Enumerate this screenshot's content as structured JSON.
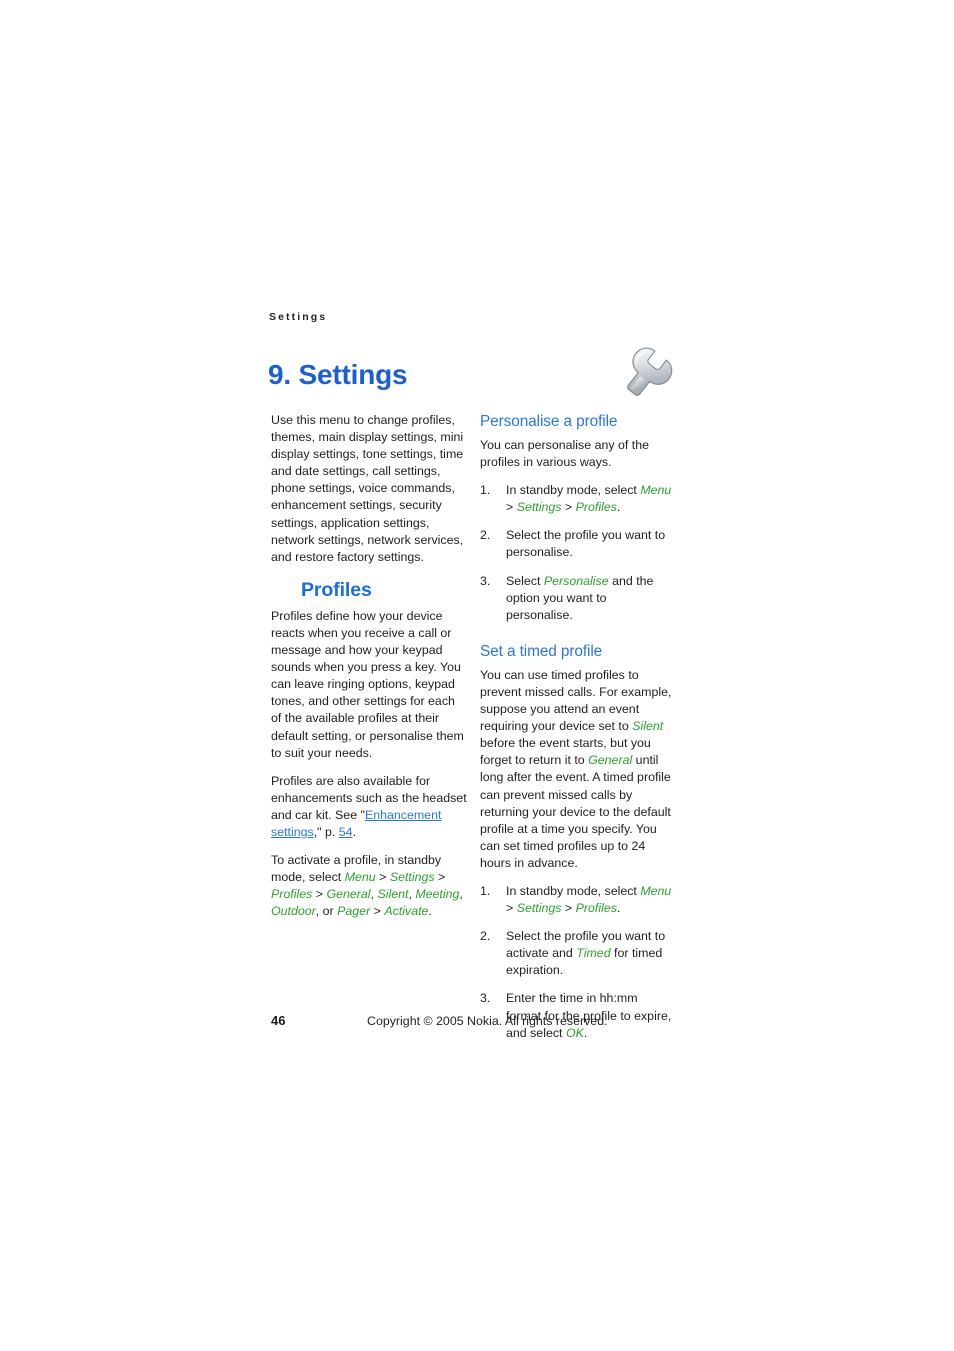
{
  "document": {
    "running_header": "Settings",
    "chapter_title": "9. Settings",
    "chapter_icon": "wrench-icon"
  },
  "colors": {
    "chapter_blue": "#1a5ed8",
    "section_blue": "#1a6de0",
    "subsection_blue": "#2878e0",
    "link_blue": "#2878e0",
    "menu_green": "#29a329",
    "body_text": "#1f1f1f",
    "page_background": "#ffffff"
  },
  "left_column": {
    "intro_paragraph": "Use this menu to change profiles, themes, main display settings, mini display settings, tone settings, time and date settings, call settings, phone settings, voice commands, enhancement settings, security settings, application settings, network settings, network services, and restore factory settings.",
    "section_title": "Profiles",
    "paragraph_1": "Profiles define how your device reacts when you receive a call or message and how your keypad sounds when you press a key. You can leave ringing options, keypad tones, and other settings for each of the available profiles at their default setting, or personalise them to suit your needs.",
    "paragraph_2": {
      "text_before_link": "Profiles are also available for enhancements such as the headset and car kit. See \"",
      "link_label": "Enhancement settings",
      "text_after_link": ",\" p. ",
      "page_link": "54",
      "text_end": "."
    },
    "paragraph_3": {
      "text_before": "To activate a profile, in standby mode, select ",
      "menu_1": "Menu",
      "sep_1": " > ",
      "menu_2": "Settings",
      "sep_2": " > ",
      "menu_3": "Profiles",
      "sep_3": " > ",
      "menu_4": "General",
      "sep_4": ", ",
      "menu_5": "Silent",
      "sep_5": ", ",
      "menu_6": "Meeting",
      "sep_6": ", ",
      "menu_7": "Outdoor",
      "sep_7": ", or ",
      "menu_8": "Pager",
      "sep_8": " > ",
      "menu_9": "Activate",
      "text_end": "."
    }
  },
  "right_column": {
    "subsection_1": {
      "title": "Personalise a profile",
      "intro": "You can personalise any of the profiles in various ways.",
      "steps": [
        {
          "number": "1.",
          "text_before": "In standby mode, select ",
          "menu_1": "Menu",
          "sep_1": " > ",
          "menu_2": "Settings",
          "sep_2": " > ",
          "menu_3": "Profiles",
          "text_end": "."
        },
        {
          "number": "2.",
          "text_before": "Select the profile you want to personalise.",
          "menu_1": "",
          "text_end": ""
        },
        {
          "number": "3.",
          "text_before": "Select ",
          "menu_1": "Personalise",
          "text_end": " and the option you want to personalise."
        }
      ]
    },
    "subsection_2": {
      "title": "Set a timed profile",
      "intro": {
        "part_1": "You can use timed profiles to prevent missed calls. For example, suppose you attend an event requiring your device set to ",
        "menu_1": "Silent",
        "part_2": " before the event starts, but you forget to return it to ",
        "menu_2": "General",
        "part_3": " until long after the event. A timed profile can prevent missed calls by returning your device to the default profile at a time you specify. You can set timed profiles up to 24 hours in advance."
      },
      "steps": [
        {
          "number": "1.",
          "text_before": "In standby mode, select ",
          "menu_1": "Menu",
          "sep_1": " > ",
          "menu_2": "Settings",
          "sep_2": " > ",
          "menu_3": "Profiles",
          "text_end": "."
        },
        {
          "number": "2.",
          "text_before": "Select the profile you want to activate and ",
          "menu_1": "Timed",
          "text_end": " for timed expiration."
        },
        {
          "number": "3.",
          "text_before": "Enter the time in hh:mm format for the profile to expire, and select ",
          "menu_1": "OK",
          "text_end": "."
        }
      ]
    }
  },
  "footer": {
    "page_number": "46",
    "copyright": "Copyright © 2005 Nokia. All rights reserved."
  }
}
